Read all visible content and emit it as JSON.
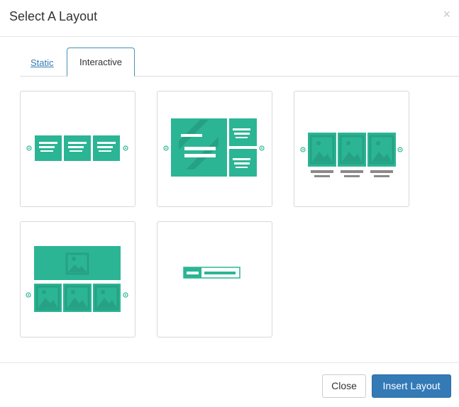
{
  "dialog": {
    "title": "Select A Layout",
    "close_symbol": "×"
  },
  "tabs": [
    {
      "label": "Static",
      "active": false
    },
    {
      "label": "Interactive",
      "active": true
    }
  ],
  "layouts": [
    {
      "name": "carousel-three-text-cards",
      "icon": "layout-carousel-text-icon"
    },
    {
      "name": "featured-with-side-list",
      "icon": "layout-featured-list-icon"
    },
    {
      "name": "image-gallery-captioned",
      "icon": "layout-gallery-captions-icon"
    },
    {
      "name": "hero-with-thumbnail-strip",
      "icon": "layout-hero-thumbnails-icon"
    },
    {
      "name": "inline-banner",
      "icon": "layout-banner-icon"
    }
  ],
  "colors": {
    "accent": "#2bb594",
    "accent_dark": "#26a184",
    "gray": "#8a8a8a",
    "primary": "#337ab7"
  },
  "footer": {
    "close_label": "Close",
    "insert_label": "Insert Layout"
  }
}
